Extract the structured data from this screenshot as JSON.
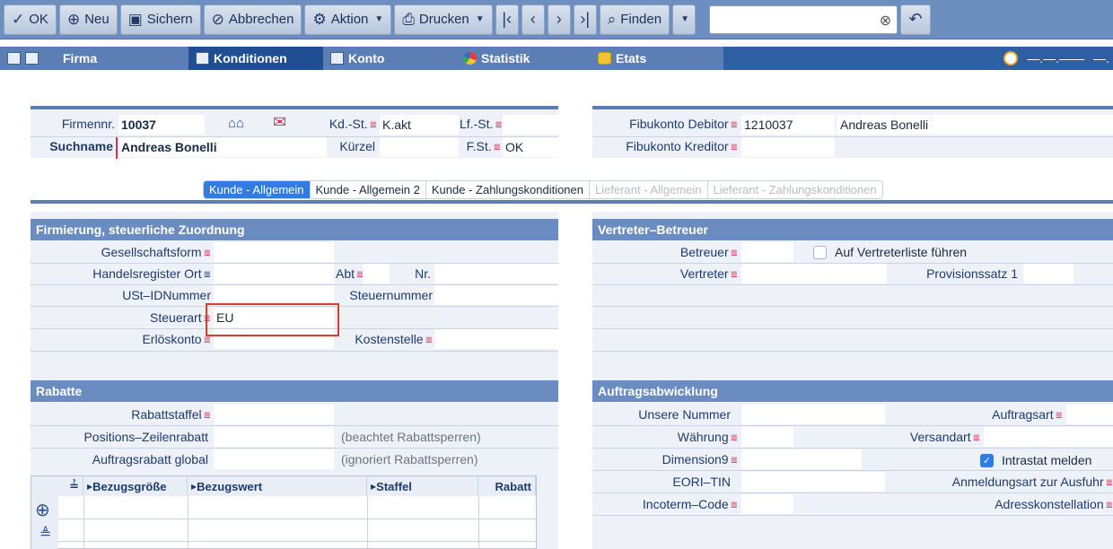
{
  "toolbar": {
    "ok": "OK",
    "neu": "Neu",
    "sichern": "Sichern",
    "abbrechen": "Abbrechen",
    "aktion": "Aktion",
    "drucken": "Drucken",
    "finden": "Finden"
  },
  "tabs": {
    "firma": "Firma",
    "konditionen": "Konditionen",
    "konto": "Konto",
    "statistik": "Statistik",
    "etats": "Etats",
    "right_1": "—.—.——",
    "right_2": "—."
  },
  "header": {
    "firmennr_label": "Firmennr.",
    "firmennr_value": "10037",
    "suchname_label": "Suchname",
    "suchname_value": "Andreas Bonelli",
    "kdst_label": "Kd.-St.",
    "kdst_value": "K.akt",
    "kuerzel_label": "Kürzel",
    "lfst_label": "Lf.-St.",
    "fst_label": "F.St.",
    "fst_value": "OK",
    "fibu_debitor_label": "Fibukonto Debitor",
    "fibu_debitor_value": "1210037",
    "fibu_debitor_name": "Andreas Bonelli",
    "fibu_kreditor_label": "Fibukonto Kreditor"
  },
  "subtabs": [
    "Kunde - Allgemein",
    "Kunde - Allgemein 2",
    "Kunde - Zahlungskonditionen",
    "Lieferant - Allgemein",
    "Lieferant - Zahlungskonditionen"
  ],
  "firmierung": {
    "title": "Firmierung, steuerliche Zuordnung",
    "gesellschaftsform": "Gesellschaftsform",
    "handelsregister": "Handelsregister Ort",
    "abt": "Abt",
    "nr": "Nr.",
    "ustid": "USt–IDNummer",
    "steuernummer": "Steuernummer",
    "steuerart": "Steuerart",
    "steuerart_value": "EU",
    "erloeskonto": "Erlöskonto",
    "kostenstelle": "Kostenstelle"
  },
  "vertreter": {
    "title": "Vertreter–Betreuer",
    "betreuer": "Betreuer",
    "vertreterliste": "Auf Vertreterliste führen",
    "vertreter": "Vertreter",
    "provisionssatz": "Provisionssatz 1"
  },
  "rabatte": {
    "title": "Rabatte",
    "rabattstaffel": "Rabattstaffel",
    "positions": "Positions–Zeilenrabatt",
    "positions_note": "(beachtet Rabattsperren)",
    "auftragsrabatt": "Auftragsrabatt global",
    "auftragsrabatt_note": "(ignoriert Rabattsperren)",
    "col_bezugsgroesse": "Bezugsgröße",
    "col_bezugswert": "Bezugswert",
    "col_staffel": "Staffel",
    "col_rabatt": "Rabatt"
  },
  "auftrag": {
    "title": "Auftragsabwicklung",
    "unsere_nummer": "Unsere Nummer",
    "auftragsart": "Auftragsart",
    "waehrung": "Währung",
    "versandart": "Versandart",
    "dimension9": "Dimension9",
    "intrastat": "Intrastat melden",
    "intrastat_checked": true,
    "eori": "EORI–TIN",
    "anmeldungsart": "Anmeldungsart zur Ausfuhr",
    "incoterm": "Incoterm–Code",
    "adresskonstellation": "Adresskonstellation"
  }
}
